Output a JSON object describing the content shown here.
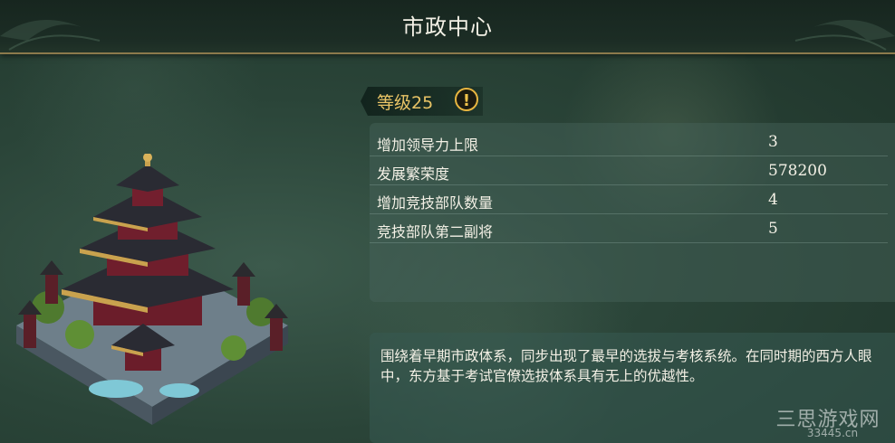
{
  "header": {
    "title": "市政中心"
  },
  "building": {
    "icon": "pagoda-building-icon"
  },
  "level": {
    "label": "等级25",
    "warn_icon": "exclamation-icon",
    "accent": "#e9c466"
  },
  "stats": [
    {
      "name": "增加领导力上限",
      "value": "3"
    },
    {
      "name": "发展繁荣度",
      "value": "578200"
    },
    {
      "name": "增加竞技部队数量",
      "value": "4"
    },
    {
      "name": "竞技部队第二副将",
      "value": "5"
    }
  ],
  "description": "围绕着早期市政体系，同步出现了最早的选拔与考核系统。在同时期的西方人眼中，东方基于考试官僚选拔体系具有无上的优越性。",
  "watermark": {
    "main": "三思游戏网",
    "sub": "33445.cn"
  }
}
